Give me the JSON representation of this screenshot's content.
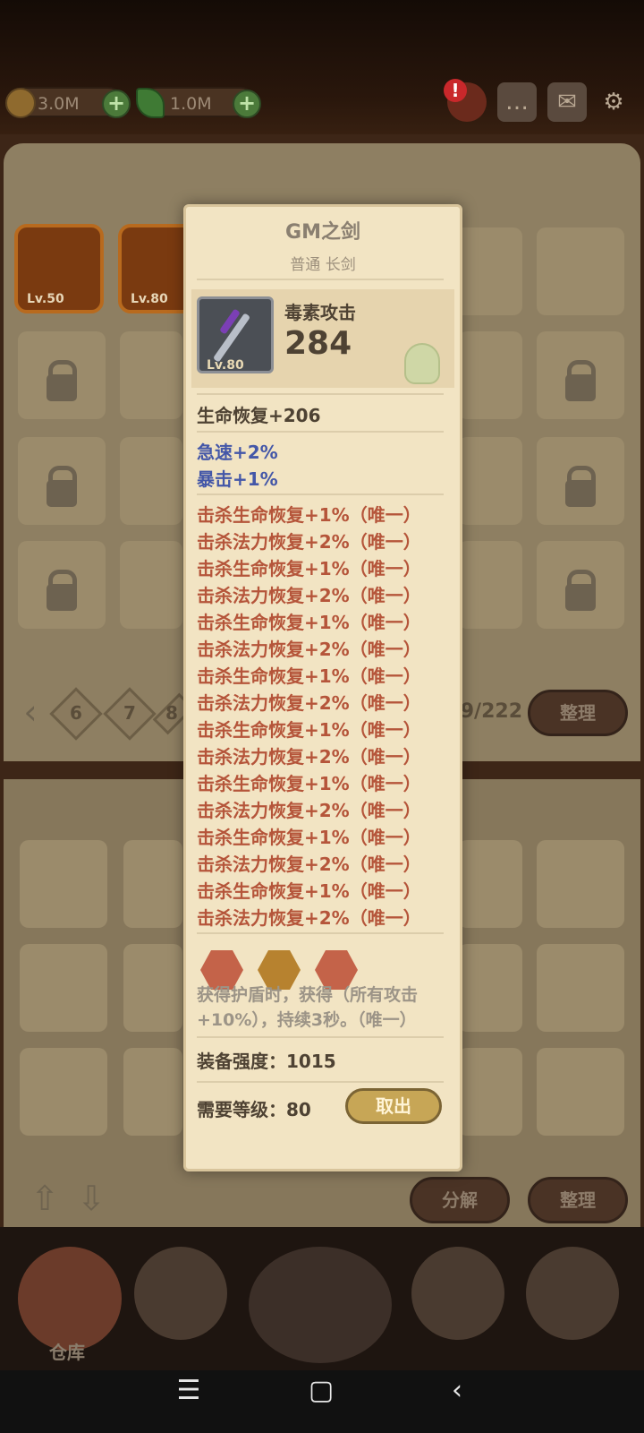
{
  "resources": {
    "gold": "3.0M",
    "gem": "1.0M"
  },
  "heroes": [
    {
      "level": "Lv.50"
    },
    {
      "level": "Lv.80"
    }
  ],
  "pagination": {
    "pages": [
      "6",
      "7",
      "8"
    ],
    "count": "9/222"
  },
  "buttons": {
    "sort": "整理",
    "sort_bottom": "整理",
    "decompose": "分解"
  },
  "nav": {
    "warehouse": "仓库"
  },
  "popup": {
    "title": "GM之剑",
    "subtitle": "普通 长剑",
    "weapon_level": "Lv.80",
    "main_attr": {
      "label": "毒素攻击",
      "value": "284"
    },
    "base_stat": "生命恢复+206",
    "blue_stats": [
      "急速+2%",
      "暴击+1%"
    ],
    "unique_stats": [
      "击杀生命恢复+1%（唯一）",
      "击杀法力恢复+2%（唯一）",
      "击杀生命恢复+1%（唯一）",
      "击杀法力恢复+2%（唯一）",
      "击杀生命恢复+1%（唯一）",
      "击杀法力恢复+2%（唯一）",
      "击杀生命恢复+1%（唯一）",
      "击杀法力恢复+2%（唯一）",
      "击杀生命恢复+1%（唯一）",
      "击杀法力恢复+2%（唯一）",
      "击杀生命恢复+1%（唯一）",
      "击杀法力恢复+2%（唯一）",
      "击杀生命恢复+1%（唯一）",
      "击杀法力恢复+2%（唯一）",
      "击杀生命恢复+1%（唯一）",
      "击杀法力恢复+2%（唯一）"
    ],
    "gem_sockets": [
      {
        "color": "#c46349"
      },
      {
        "color": "#b7822f"
      },
      {
        "color": "#c46349"
      }
    ],
    "effect_desc": "获得护盾时，获得（所有攻击+10%），持续3秒。（唯一）",
    "gear_score": "装备强度：1015",
    "required_level": "需要等级：80",
    "take_out": "取出"
  },
  "colors": {
    "unique_stat": "#b5553a",
    "blue_stat": "#4457a8",
    "base_stat": "#4e4233"
  }
}
